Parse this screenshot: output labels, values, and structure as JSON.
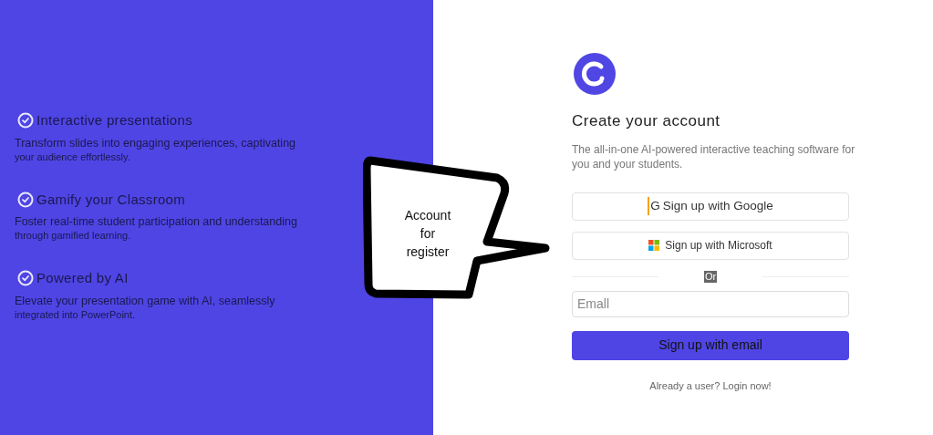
{
  "features": [
    {
      "title": "Interactive presentations",
      "description": [
        "Transform slides into engaging experiences, captivating",
        "your audience effortlessly."
      ]
    },
    {
      "title": "Gamify your Classroom",
      "description": [
        "Foster real-time student participation and understanding",
        "through gamified learning."
      ]
    },
    {
      "title": "Powered by AI",
      "description": [
        "Elevate your presentation game with AI, seamlessly",
        "integrated into PowerPoint."
      ]
    }
  ],
  "callout": {
    "lines": [
      "Account",
      "for",
      "register"
    ]
  },
  "signup": {
    "title": "Create your account",
    "subtitle": "The all-in-one AI-powered interactive teaching software for you and your students.",
    "buttons": [
      {
        "kind": "google",
        "icon_text": "G",
        "label": "Sign up with Google"
      },
      {
        "kind": "microsoft",
        "label": "Sign up with Microsoft"
      }
    ],
    "divider": "Or",
    "email": {
      "placeholder": "Emall"
    },
    "submit": "Sign up with email",
    "login_link": "Already a user? Login now!"
  }
}
